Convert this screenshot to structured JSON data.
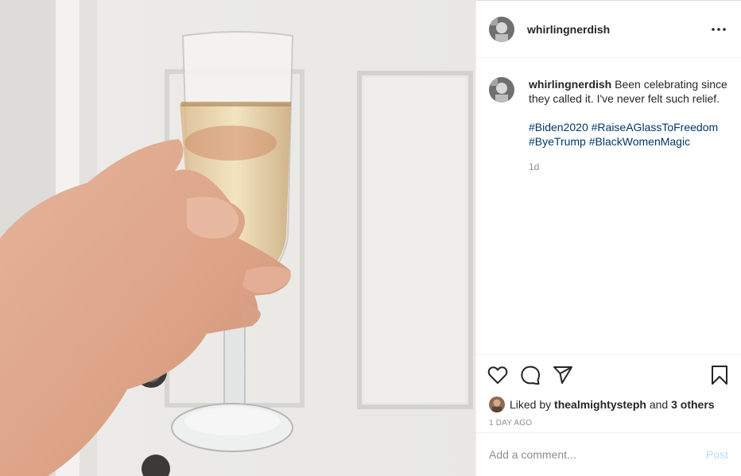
{
  "post": {
    "photo_alt": "Hand holding a champagne flute in front of a white door",
    "author": "whirlingnerdish",
    "caption": {
      "username": "whirlingnerdish",
      "text": "Been celebrating since they called it. I've never felt such relief.",
      "hashtags": [
        "#Biden2020",
        "#RaiseAGlassToFreedom",
        "#ByeTrump",
        "#BlackWomenMagic"
      ],
      "time": "1d"
    },
    "likes": {
      "prefix": "Liked by",
      "user": "thealmightysteph",
      "joiner": "and",
      "others": "3 others"
    },
    "age": "1 DAY AGO",
    "comment": {
      "placeholder": "Add a comment...",
      "post_label": "Post"
    }
  },
  "icons": {
    "more": "more-options-icon",
    "like": "heart-icon",
    "comment": "comment-icon",
    "share": "share-icon",
    "save": "bookmark-icon"
  },
  "colors": {
    "text": "#262626",
    "muted": "#8e8e8e",
    "hashtag": "#00376b",
    "post_disabled": "#b2dffc",
    "divider": "#efefef"
  }
}
